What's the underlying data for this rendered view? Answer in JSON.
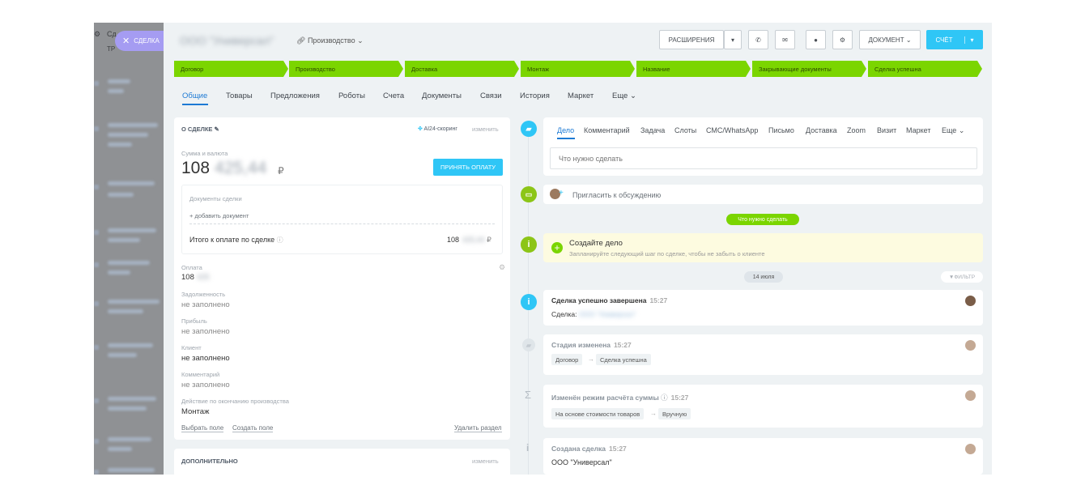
{
  "overlay": {
    "close_label": "СДЕЛКА",
    "header_fragment": "Сд",
    "header_fragment2": "ТР"
  },
  "header": {
    "deal_name": "ООО \"Универсал\"",
    "stage_dropdown": "Производство",
    "extensions_label": "РАСШИРЕНИЯ",
    "document_label": "ДОКУМЕНТ",
    "account_label": "СЧЁТ"
  },
  "stages": [
    "Договор",
    "Производство",
    "Доставка",
    "Монтаж",
    "Название",
    "Закрывающие документы",
    "Сделка успешна"
  ],
  "tabs": [
    "Общие",
    "Товары",
    "Предложения",
    "Роботы",
    "Счета",
    "Документы",
    "Связи",
    "История",
    "Маркет",
    "Еще"
  ],
  "about": {
    "title": "О СДЕЛКЕ",
    "ai_label": "AI24-скоринг",
    "edit_label": "изменить",
    "sum_label": "Сумма и валюта",
    "sum_value": "108",
    "sum_blur": "425,44",
    "currency": "₽",
    "accept_payment": "ПРИНЯТЬ ОПЛАТУ",
    "docs_label": "Документы сделки",
    "add_doc": "+ добавить документ",
    "total_label": "Итого к оплате по сделке",
    "total_value": "108",
    "total_blur": "425,44",
    "payment_label": "Оплата",
    "payment_value": "108",
    "payment_blur": "425",
    "debt_label": "Задолженность",
    "debt_value": "не заполнено",
    "profit_label": "Прибыль",
    "profit_value": "не заполнено",
    "client_label": "Клиент",
    "client_value": "не заполнено",
    "comment_label": "Комментарий",
    "comment_value": "не заполнено",
    "action_label": "Действие по окончанию производства",
    "action_value": "Монтаж",
    "choose_field": "Выбрать поле",
    "create_field": "Создать поле",
    "delete_section": "Удалить раздел"
  },
  "additional": {
    "title": "ДОПОЛНИТЕЛЬНО",
    "edit_label": "изменить"
  },
  "activity": {
    "tabs": [
      "Дело",
      "Комментарий",
      "Задача",
      "Слоты",
      "СМС/WhatsApp",
      "Письмо",
      "Доставка",
      "Zoom",
      "Визит",
      "Маркет",
      "Еще"
    ],
    "placeholder": "Что нужно сделать",
    "invite": "Пригласить к обсуждению",
    "todo_pill": "Что нужно сделать",
    "create_title": "Создайте дело",
    "create_sub": "Запланируйте следующий шаг по сделке, чтобы не забыть о клиенте",
    "date_pill": "14 июля",
    "filter": "ФИЛЬТР"
  },
  "events": [
    {
      "title": "Сделка успешно завершена",
      "time": "15:27",
      "line_label": "Сделка:",
      "line_blur": "ООО \"Универсал\""
    },
    {
      "title": "Стадия изменена",
      "time": "15:27",
      "from": "Договор",
      "to": "Сделка успешна"
    },
    {
      "title": "Изменён режим расчёта суммы",
      "time": "15:27",
      "from": "На основе стоимости товаров",
      "to": "Вручную"
    },
    {
      "title": "Создана сделка",
      "time": "15:27",
      "value": "ООО \"Универсал\""
    }
  ],
  "colors": {
    "stage": "#7bd500",
    "accent": "#2fc6f6",
    "tab_active": "#1d7ad4",
    "panel_bg": "#eef2f4"
  }
}
